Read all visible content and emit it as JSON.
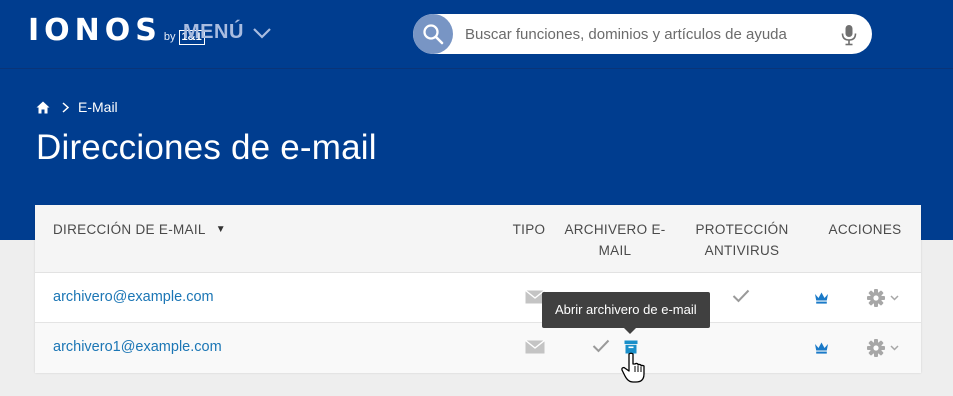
{
  "header": {
    "logo": "IONOS",
    "logo_by": "by",
    "logo_brand": "1&1",
    "menu_label": "MENÚ",
    "search_placeholder": "Buscar funciones, dominios y artículos de ayuda"
  },
  "breadcrumb": {
    "current": "E-Mail"
  },
  "page_title": "Direcciones de e-mail",
  "table": {
    "columns": {
      "email": "DIRECCIÓN DE E-MAIL",
      "type": "TIPO",
      "archive_line1": "ARCHIVERO E-",
      "archive_line2": "MAIL",
      "antivirus_line1": "PROTECCIÓN",
      "antivirus_line2": "ANTIVIRUS",
      "actions": "ACCIONES"
    },
    "rows": [
      {
        "email": "archivero@example.com"
      },
      {
        "email": "archivero1@example.com"
      }
    ]
  },
  "tooltip": "Abrir archivero de e-mail",
  "colors": {
    "navy": "#003d8f",
    "link": "#1b76b5",
    "premium": "#1a7ac8",
    "check": "#9a9a9a"
  }
}
